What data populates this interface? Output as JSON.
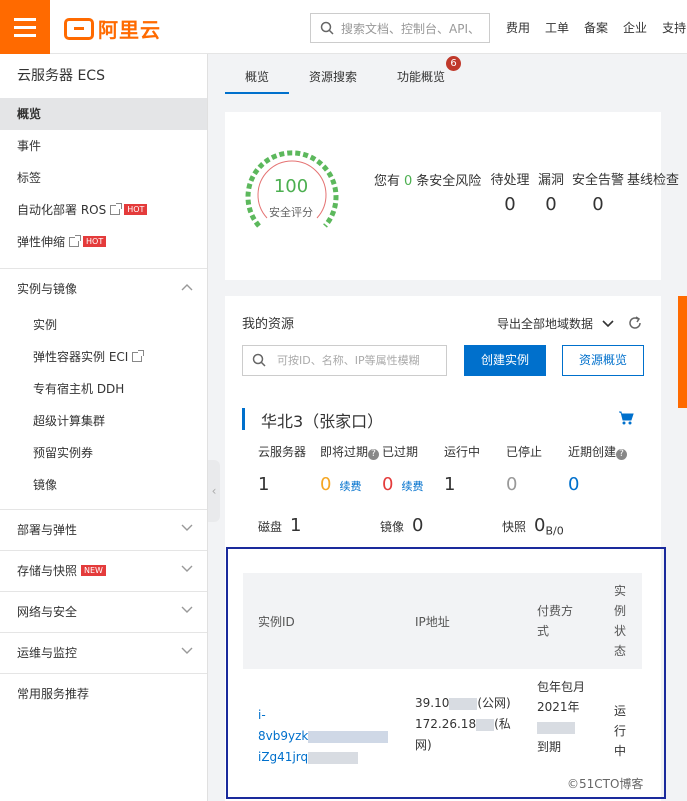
{
  "topbar": {
    "brand": "阿里云",
    "search_placeholder": "搜索文档、控制台、API、",
    "nav": [
      "费用",
      "工单",
      "备案",
      "企业",
      "支持"
    ]
  },
  "sidebar": {
    "title": "云服务器 ECS",
    "items": [
      {
        "label": "概览",
        "active": true
      },
      {
        "label": "事件"
      },
      {
        "label": "标签"
      },
      {
        "label": "自动化部署 ROS",
        "hot": "HOT"
      },
      {
        "label": "弹性伸缩",
        "hot": "HOT"
      }
    ],
    "group_instances": "实例与镜像",
    "sub_items": [
      "实例",
      "弹性容器实例 ECI",
      "专有宿主机 DDH",
      "超级计算集群",
      "预留实例券",
      "镜像"
    ],
    "groups": [
      "部署与弹性",
      "存储与快照",
      "网络与安全",
      "运维与监控",
      "常用服务推荐"
    ],
    "new_badge": "NEW"
  },
  "tabs": [
    {
      "label": "概览",
      "active": true
    },
    {
      "label": "资源搜索"
    },
    {
      "label": "功能概览",
      "badge": "6"
    }
  ],
  "security": {
    "score": "100",
    "score_label": "安全评分",
    "risk_prefix": "您有",
    "risk_count": "0",
    "risk_suffix": "条安全风险",
    "columns": [
      {
        "label": "待处理",
        "value": "0"
      },
      {
        "label": "漏洞",
        "value": "0"
      },
      {
        "label": "安全告警",
        "value": "0"
      },
      {
        "label": "基线检查",
        "value": ""
      }
    ]
  },
  "resources": {
    "title": "我的资源",
    "export": "导出全部地域数据",
    "search_placeholder": "可按ID、名称、IP等属性模糊",
    "create_button": "创建实例",
    "overview_button": "资源概览",
    "region": "华北3（张家口）",
    "stats": [
      {
        "label": "云服务器",
        "value": "1"
      },
      {
        "label": "即将过期",
        "value": "0",
        "link": "续费"
      },
      {
        "label": "已过期",
        "value": "0",
        "link": "续费"
      },
      {
        "label": "运行中",
        "value": "1"
      },
      {
        "label": "已停止",
        "value": "0"
      },
      {
        "label": "近期创建",
        "value": "0"
      }
    ],
    "disk_label": "磁盘",
    "disk_value": "1",
    "image_label": "镜像",
    "image_value": "0",
    "snapshot_label": "快照",
    "snapshot_value": "0",
    "snapshot_unit": "B/0"
  },
  "table": {
    "headers": [
      "实例ID",
      "IP地址",
      "付费方式",
      "实例状态"
    ],
    "row": {
      "id_line1": "i-",
      "id_line2": "8vb9yzk",
      "id_line3": "iZg41jrq",
      "ip_public": "39.10",
      "ip_public_tag": "(公网)",
      "ip_private": "172.26.18",
      "ip_private_tag": "(私网)",
      "pay_line1": "包年包月",
      "pay_line2": "2021年",
      "pay_line3": "到期",
      "status": "运行中"
    }
  },
  "watermark": "©51CTO博客"
}
